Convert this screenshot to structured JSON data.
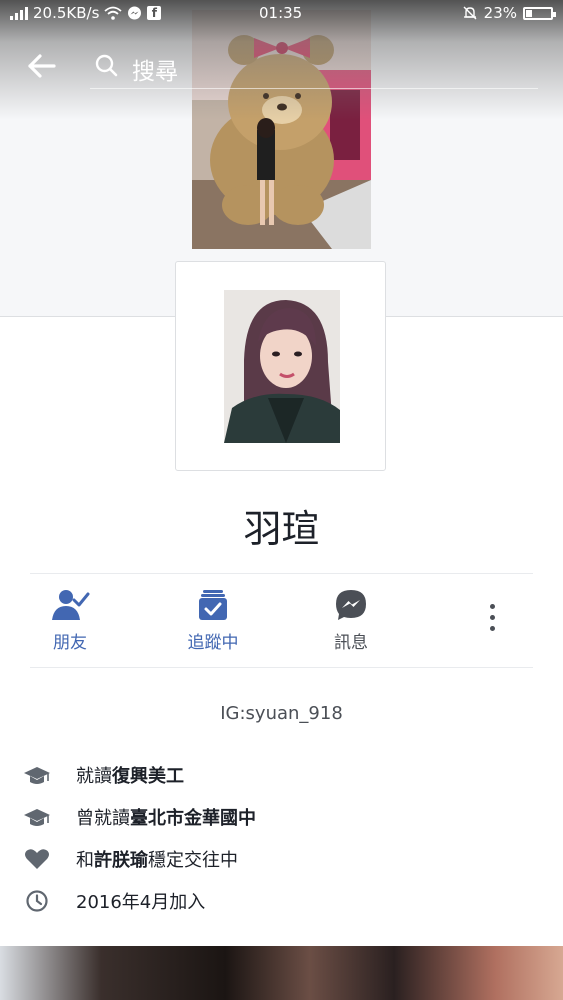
{
  "status_bar": {
    "speed": "20.5KB/s",
    "time": "01:35",
    "battery_text": "23%",
    "battery_level": 0.23
  },
  "search": {
    "placeholder": "搜尋"
  },
  "profile": {
    "name": "羽瑄"
  },
  "actions": {
    "friends_label": "朋友",
    "following_label": "追蹤中",
    "message_label": "訊息"
  },
  "intro": {
    "bio": "IG:syuan_918",
    "items": [
      {
        "icon": "graduation-cap-icon",
        "prefix": "就讀",
        "bold": "復興美工",
        "suffix": ""
      },
      {
        "icon": "graduation-cap-icon",
        "prefix": "曾就讀",
        "bold": "臺北市金華國中",
        "suffix": ""
      },
      {
        "icon": "heart-icon",
        "prefix": "和",
        "bold": "許朕瑜",
        "suffix": "穩定交往中"
      },
      {
        "icon": "clock-icon",
        "prefix": "2016年4月加入",
        "bold": "",
        "suffix": ""
      }
    ]
  },
  "colors": {
    "accent": "#4267b2",
    "messenger": "#4b4f56",
    "text": "#1d2129",
    "secondary_text": "#4b4f56"
  }
}
